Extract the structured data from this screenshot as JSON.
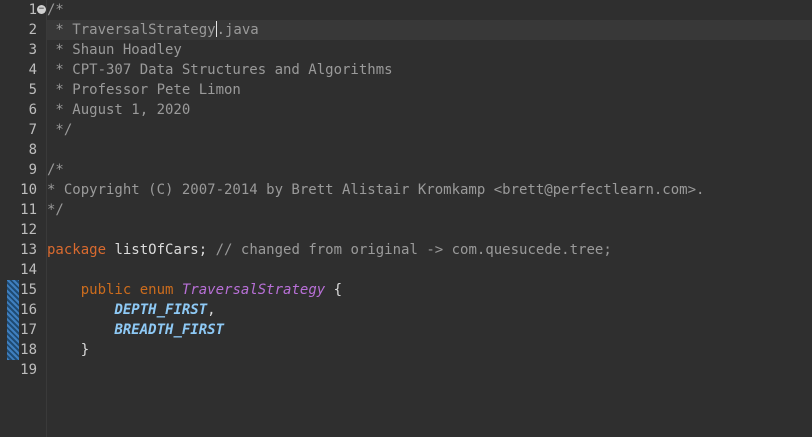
{
  "gutter": {
    "line_numbers": [
      "1",
      "2",
      "3",
      "4",
      "5",
      "6",
      "7",
      "8",
      "9",
      "10",
      "11",
      "12",
      "13",
      "14",
      "15",
      "16",
      "17",
      "18",
      "19"
    ],
    "fold_marker": "−"
  },
  "code": {
    "l1": "/*",
    "l2_a": " * TraversalStrategy",
    "l2_b": ".java",
    "l3": " * Shaun Hoadley",
    "l4": " * CPT-307 Data Structures and Algorithms",
    "l5": " * Professor Pete Limon",
    "l6": " * August 1, 2020",
    "l7": " */",
    "l9": "/*",
    "l10": "* Copyright (C) 2007-2014 by Brett Alistair Kromkamp <brett@perfectlearn.com>.",
    "l11": "*/",
    "l13_kw": "package",
    "l13_name": " listOfCars;",
    "l13_comment": " // changed from original -> com.quesucede.tree;",
    "l15_indent": "    ",
    "l15_kw1": "public",
    "l15_sp1": " ",
    "l15_kw2": "enum",
    "l15_sp2": " ",
    "l15_type": "TraversalStrategy",
    "l15_brace": " {",
    "l16_indent": "        ",
    "l16_const": "DEPTH_FIRST",
    "l16_comma": ",",
    "l17_indent": "        ",
    "l17_const": "BREADTH_FIRST",
    "l18": "    }"
  },
  "colors": {
    "background": "#2f2f2f",
    "comment": "#9a9a9a",
    "keyword": "#d96a2f",
    "enum_type": "#b870d7",
    "enum_constant": "#8ec9f5",
    "current_line": "#383838",
    "change_bar": "#3f7fbf"
  }
}
